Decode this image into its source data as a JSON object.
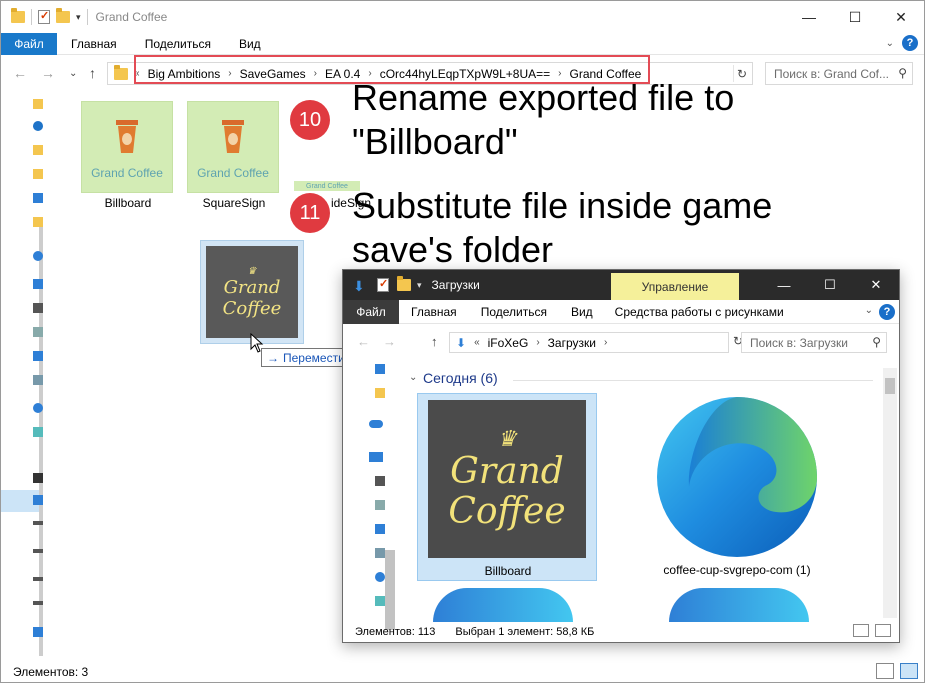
{
  "main": {
    "title": "Grand Coffee",
    "ribbon": {
      "file": "Файл",
      "home": "Главная",
      "share": "Поделиться",
      "view": "Вид"
    },
    "breadcrumb": [
      "Big Ambitions",
      "SaveGames",
      "EA 0.4",
      "cOrc44hyLEqpTXpW9L+8UA==",
      "Grand Coffee"
    ],
    "search_placeholder": "Поиск в: Grand Cof...",
    "files": [
      {
        "name": "Billboard",
        "brand": "Grand Coffee"
      },
      {
        "name": "SquareSign",
        "brand": "Grand Coffee"
      },
      {
        "name": "ideSign",
        "brand": "Grand Coffee"
      }
    ],
    "drag_tooltip": "Переместить в \"Grand Coffee\"",
    "status": "Элементов: 3",
    "accent_color": "#1979ca",
    "highlight_color": "#e34b55"
  },
  "annotations": [
    {
      "number": "10",
      "text1": "Rename exported file to",
      "text2": "\"Billboard\""
    },
    {
      "number": "11",
      "text1": "Substitute file inside game",
      "text2": "save's folder"
    }
  ],
  "downloads": {
    "title": "Загрузки",
    "contextual_tab": "Управление",
    "ribbon": {
      "file": "Файл",
      "home": "Главная",
      "share": "Поделиться",
      "view": "Вид",
      "tools": "Средства работы с рисунками"
    },
    "breadcrumb": [
      "iFoXeG",
      "Загрузки"
    ],
    "search_placeholder": "Поиск в: Загрузки",
    "group": "Сегодня (6)",
    "files": [
      {
        "name": "Billboard",
        "art_line1": "Grand",
        "art_line2": "Coffee"
      },
      {
        "name": "coffee-cup-svgrepo-com (1)"
      }
    ],
    "status_count": "Элементов: 113",
    "status_selected": "Выбран 1 элемент: 58,8 КБ"
  }
}
